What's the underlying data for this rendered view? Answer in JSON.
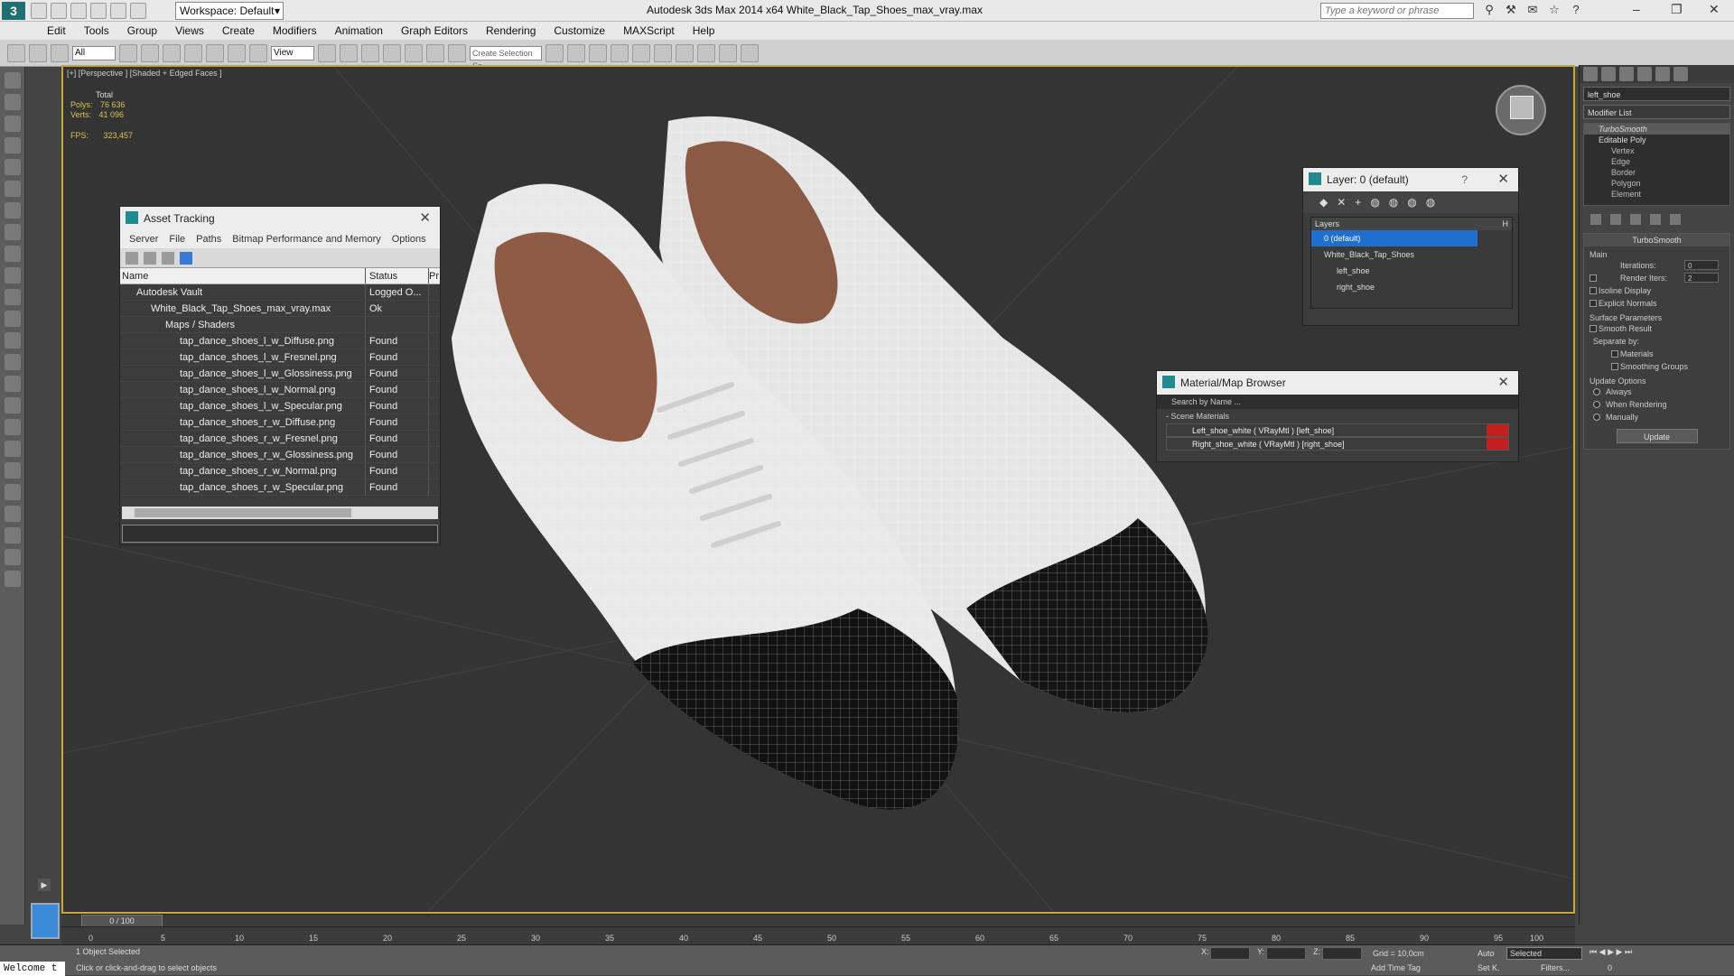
{
  "app": {
    "logo": "3",
    "workspace": "Workspace: Default",
    "title": "Autodesk 3ds Max  2014 x64     White_Black_Tap_Shoes_max_vray.max",
    "search_placeholder": "Type a keyword or phrase"
  },
  "menu": [
    "Edit",
    "Tools",
    "Group",
    "Views",
    "Create",
    "Modifiers",
    "Animation",
    "Graph Editors",
    "Rendering",
    "Customize",
    "MAXScript",
    "Help"
  ],
  "toolbar": {
    "filter": "All",
    "refcoord": "View",
    "selset": "Create Selection Se"
  },
  "viewport": {
    "label": "[+] [Perspective ] [Shaded + Edged Faces ]",
    "stats_total": "Total",
    "polys_label": "Polys:",
    "polys": "76 636",
    "verts_label": "Verts:",
    "verts": "41 096",
    "fps_label": "FPS:",
    "fps": "323,457"
  },
  "asset_tracking": {
    "title": "Asset Tracking",
    "menu": [
      "Server",
      "File",
      "Paths",
      "Bitmap Performance and Memory",
      "Options"
    ],
    "col_name": "Name",
    "col_status": "Status",
    "col_pr": "Pr",
    "rows": [
      {
        "name": "Autodesk Vault",
        "status": "Logged O...",
        "indent": 1
      },
      {
        "name": "White_Black_Tap_Shoes_max_vray.max",
        "status": "Ok",
        "indent": 2
      },
      {
        "name": "Maps / Shaders",
        "status": "",
        "indent": 3
      },
      {
        "name": "tap_dance_shoes_l_w_Diffuse.png",
        "status": "Found",
        "indent": 4
      },
      {
        "name": "tap_dance_shoes_l_w_Fresnel.png",
        "status": "Found",
        "indent": 4
      },
      {
        "name": "tap_dance_shoes_l_w_Glossiness.png",
        "status": "Found",
        "indent": 4
      },
      {
        "name": "tap_dance_shoes_l_w_Normal.png",
        "status": "Found",
        "indent": 4
      },
      {
        "name": "tap_dance_shoes_l_w_Specular.png",
        "status": "Found",
        "indent": 4
      },
      {
        "name": "tap_dance_shoes_r_w_Diffuse.png",
        "status": "Found",
        "indent": 4
      },
      {
        "name": "tap_dance_shoes_r_w_Fresnel.png",
        "status": "Found",
        "indent": 4
      },
      {
        "name": "tap_dance_shoes_r_w_Glossiness.png",
        "status": "Found",
        "indent": 4
      },
      {
        "name": "tap_dance_shoes_r_w_Normal.png",
        "status": "Found",
        "indent": 4
      },
      {
        "name": "tap_dance_shoes_r_w_Specular.png",
        "status": "Found",
        "indent": 4
      }
    ]
  },
  "layer": {
    "title": "Layer: 0 (default)",
    "help": "?",
    "header": "Layers",
    "col_h": "H",
    "items": [
      "0 (default)",
      "White_Black_Tap_Shoes",
      "left_shoe",
      "right_shoe"
    ]
  },
  "material_browser": {
    "title": "Material/Map Browser",
    "search": "Search by Name ...",
    "group": "- Scene Materials",
    "items": [
      "Left_shoe_white  ( VRayMtl ) [left_shoe]",
      "Right_shoe_white  ( VRayMtl ) [right_shoe]"
    ]
  },
  "command_panel": {
    "object_name": "left_shoe",
    "modifier_list": "Modifier List",
    "stack": [
      "TurboSmooth",
      "Editable Poly",
      "Vertex",
      "Edge",
      "Border",
      "Polygon",
      "Element"
    ],
    "turbosmooth": {
      "title": "TurboSmooth",
      "main": "Main",
      "iterations_label": "Iterations:",
      "iterations": "0",
      "render_iters_label": "Render Iters:",
      "render_iters": "2",
      "isoline": "Isoline Display",
      "explicit": "Explicit Normals",
      "surface": "Surface Parameters",
      "smooth_result": "Smooth Result",
      "separate_by": "Separate by:",
      "materials": "Materials",
      "smoothing_groups": "Smoothing Groups",
      "update_options": "Update Options",
      "always": "Always",
      "when_rendering": "When Rendering",
      "manually": "Manually",
      "update": "Update"
    }
  },
  "timeline": {
    "slider": "0 / 100",
    "ticks": [
      "0",
      "5",
      "10",
      "15",
      "20",
      "25",
      "30",
      "35",
      "40",
      "45",
      "50",
      "55",
      "60",
      "65",
      "70",
      "75",
      "80",
      "85",
      "90",
      "95",
      "100"
    ]
  },
  "status": {
    "welcome": "Welcome t",
    "selected": "1 Object Selected",
    "prompt": "Click or click-and-drag to select objects",
    "x": "X:",
    "y": "Y:",
    "z": "Z:",
    "grid": "Grid = 10,0cm",
    "add_time_tag": "Add Time Tag",
    "auto": "Auto",
    "selected_dd": "Selected",
    "set_k": "Set K.",
    "filters": "Filters...",
    "frame": "0"
  }
}
